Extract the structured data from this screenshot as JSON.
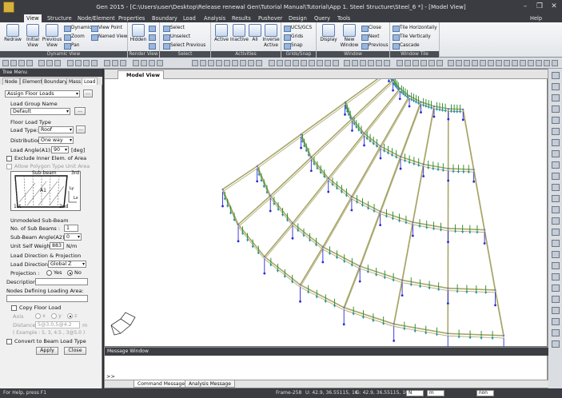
{
  "window": {
    "title": "Gen 2015 - [C:\\Users\\user\\Desktop\\Release renewal Gen\\Tutorial Manual\\Tutorial\\App 1. Steel Structure\\Steel_6 *] - [Model View]",
    "minimize": "–",
    "restore": "❐",
    "close": "✕"
  },
  "menu": {
    "tabs": [
      "View",
      "Structure",
      "Node/Element",
      "Properties",
      "Boundary",
      "Load",
      "Analysis",
      "Results",
      "Pushover",
      "Design",
      "Query",
      "Tools"
    ],
    "active": "View",
    "help": "Help"
  },
  "ribbon": {
    "dynamic_view": {
      "label": "Dynamic View",
      "redraw": "Redraw",
      "initial_view": "Initial View",
      "previous_view": "Previous View",
      "dynamic": "Dynamic",
      "zoom": "Zoom",
      "pan": "Pan",
      "view_point": "View Point",
      "named_view": "Named View"
    },
    "render_view": {
      "label": "Render View",
      "hidden": "Hidden"
    },
    "select": {
      "label": "Select",
      "select": "Select",
      "unselect": "Unselect",
      "select_previous": "Select Previous"
    },
    "activities": {
      "label": "Activities",
      "active": "Active",
      "inactive": "Inactive",
      "all": "All",
      "inverse_active": "Inverse Active"
    },
    "grids_snap": {
      "label": "Grids/Snap",
      "ucs_gcs": "UCS/GCS",
      "grids": "Grids",
      "snap": "Snap"
    },
    "window": {
      "label": "Window",
      "display": "Display",
      "new_window": "New Window",
      "close": "Close",
      "next": "Next",
      "previous": "Previous"
    },
    "window_tile": {
      "label": "Window Tile",
      "tile_horizontally": "Tile Horizontally",
      "tile_vertically": "Tile Vertically",
      "cascade": "Cascade"
    }
  },
  "tree_menu": {
    "title": "Tree Menu",
    "tabs": [
      "Node",
      "Element",
      "Boundary",
      "Mass",
      "Load"
    ],
    "active_tab": "Load",
    "function": "Assign Floor Loads",
    "load_group_name_label": "Load Group Name",
    "load_group_value": "Default",
    "more_btn": "...",
    "floor_load_type_label": "Floor Load Type",
    "load_type_label": "Load Type:",
    "load_type_value": "Roof",
    "distribution_label": "Distribution:",
    "distribution_value": "One way",
    "load_angle_label": "Load Angle(A1):",
    "load_angle_value": "90",
    "load_angle_unit": "[deg]",
    "exclude_inner": "Exclude Inner Elem. of Area",
    "allow_polygon": "Allow Polygon Type Unit Area",
    "diagram": {
      "sub_beam": "Sub-beam",
      "third": "3rd",
      "a1": "A1",
      "first": "1st",
      "second": "2nd",
      "lx": "Lx",
      "ly": "Ly"
    },
    "unmodeled_label": "Unmodeled Sub-Beam",
    "no_sub_beams_label": "No. of Sub Beams :",
    "no_sub_beams_value": "1",
    "sub_beam_angle_label": "Sub-Beam Angle(A2):",
    "sub_beam_angle_value": "0",
    "unit_self_weight_label": "Unit Self Weight:",
    "unit_self_weight_value": "883",
    "unit_self_weight_unit": "N/m",
    "load_dir_proj_label": "Load Direction & Projection",
    "load_direction_label": "Load Direction :",
    "load_direction_value": "Global Z",
    "projection_label": "Projection :",
    "projection_yes": "Yes",
    "projection_no": "No",
    "projection_selected": "No",
    "description_label": "Description:",
    "description_value": "",
    "nodes_defining_label": "Nodes Defining Loading Area:",
    "nodes_value": "",
    "copy_floor_load": "Copy Floor Load",
    "axis_label": "Axis",
    "axis_x": "x",
    "axis_y": "y",
    "axis_z": "z",
    "distances_label": "Distances",
    "distances_value": "5@3.0,5@4.2",
    "distances_unit": "m",
    "example_text": "( Example :   5, 3, 4.5 , 3@5.0 )",
    "convert_label": "Convert to Beam Load Type",
    "apply": "Apply",
    "close": "Close"
  },
  "model_view": {
    "tab_label": "Model View"
  },
  "message_window": {
    "title": "Message Window",
    "prompt": ">>",
    "tabs": [
      "Command Message",
      "Analysis Message"
    ],
    "active_tab": "Command Message"
  },
  "status": {
    "help_text": "For Help, press F1",
    "frame": "Frame-258",
    "u_coord": "U: 42.9, 36.55115, 16",
    "g_coord": "G: 42.9, 36.55115, 16",
    "unit_force": "N",
    "unit_length": "m",
    "none_label": "non"
  },
  "colors": {
    "steel_member": "#a8a66a",
    "load_arrow": "#1f8a1f",
    "load_arrow_head": "#1d8fb8",
    "support": "#2a2ad8",
    "node": "#6b6bd8"
  }
}
